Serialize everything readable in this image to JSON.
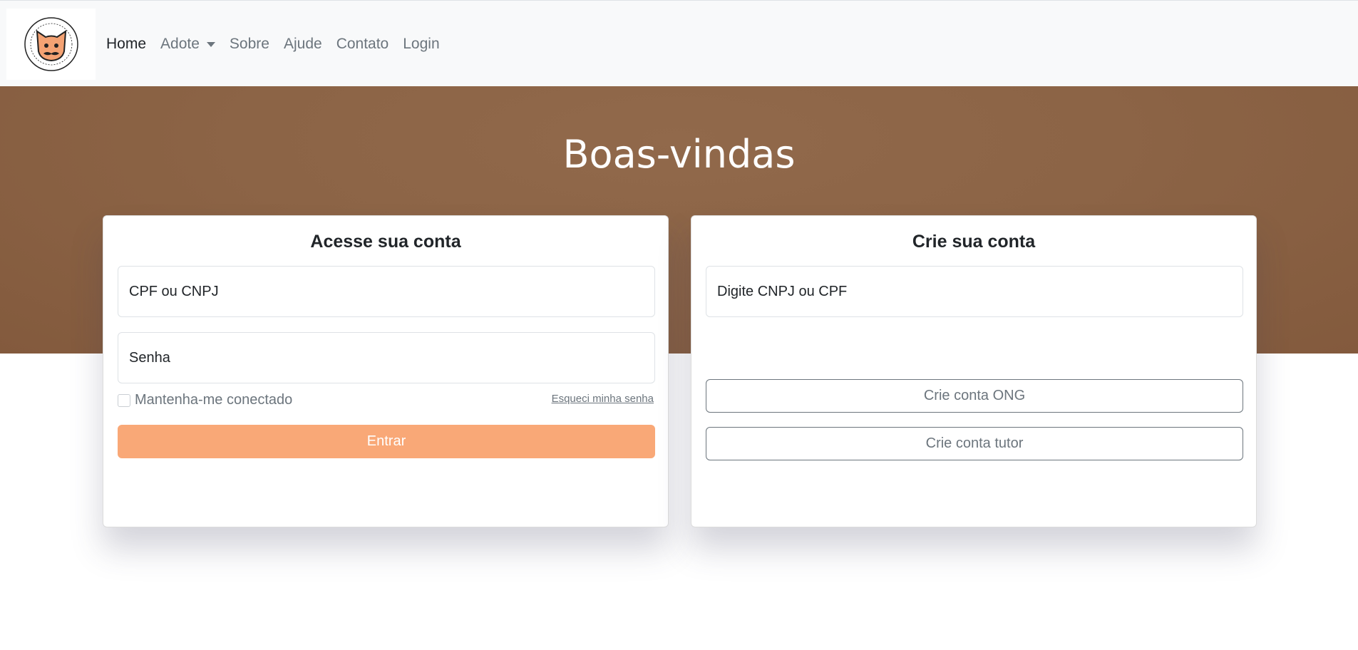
{
  "navbar": {
    "logo_text": "GATO DE BIGODES",
    "links": [
      {
        "label": "Home",
        "active": true
      },
      {
        "label": "Adote",
        "dropdown": true
      },
      {
        "label": "Sobre"
      },
      {
        "label": "Ajude"
      },
      {
        "label": "Contato"
      },
      {
        "label": "Login"
      }
    ]
  },
  "hero": {
    "title": "Boas-vindas",
    "background_color": "#8c6446"
  },
  "login_card": {
    "title": "Acesse sua conta",
    "id_placeholder": "CPF ou CNPJ",
    "password_placeholder": "Senha",
    "remember_label": "Mantenha-me conectado",
    "forgot_link": "Esqueci minha senha",
    "submit_label": "Entrar",
    "submit_color": "#f9a877"
  },
  "signup_card": {
    "title": "Crie sua conta",
    "id_placeholder": "Digite CNPJ ou CPF",
    "ong_button": "Crie conta ONG",
    "tutor_button": "Crie conta tutor"
  }
}
